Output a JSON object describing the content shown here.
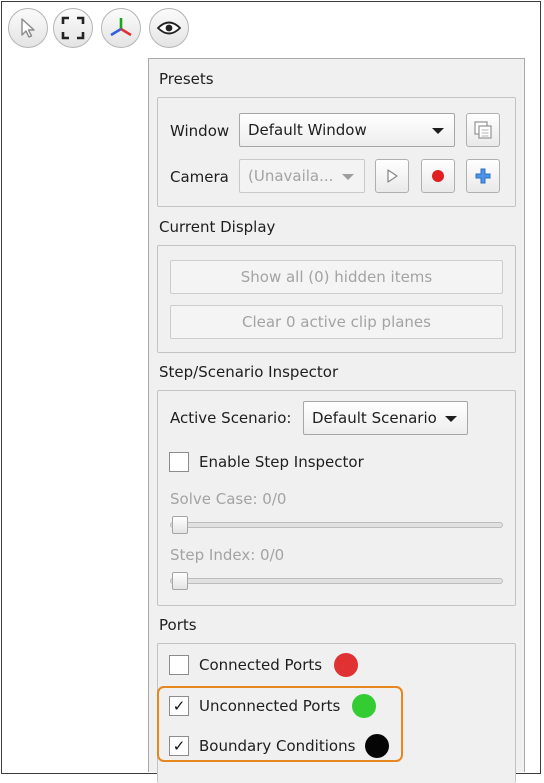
{
  "toolbar": {
    "buttons": [
      {
        "name": "select-pointer",
        "icon": "cursor-arrow-icon"
      },
      {
        "name": "fit-to-view",
        "icon": "fullscreen-corners-icon"
      },
      {
        "name": "axes-triad",
        "icon": "xyz-axes-icon"
      },
      {
        "name": "visibility",
        "icon": "eye-icon"
      }
    ]
  },
  "presets": {
    "title": "Presets",
    "window_label": "Window",
    "window_value": "Default Window",
    "camera_label": "Camera",
    "camera_value": "(Unavaila...",
    "icons": [
      "copy-window-icon",
      "play-icon",
      "record-icon",
      "add-camera-icon"
    ]
  },
  "current_display": {
    "title": "Current Display",
    "show_hidden_label": "Show all (0) hidden items",
    "clear_clip_label": "Clear 0 active clip planes"
  },
  "step_inspector": {
    "title": "Step/Scenario Inspector",
    "active_scenario_label": "Active Scenario:",
    "active_scenario_value": "Default Scenario",
    "enable_label": "Enable Step Inspector",
    "enable_checked": false,
    "solve_case_label": "Solve Case: 0/0",
    "step_index_label": "Step Index: 0/0",
    "solve_case_slider_fraction": 0,
    "step_index_slider_fraction": 0
  },
  "ports": {
    "title": "Ports",
    "items": [
      {
        "label": "Connected Ports",
        "checked": false,
        "check_glyph": "",
        "color": "#e03232"
      },
      {
        "label": "Unconnected Ports",
        "checked": true,
        "check_glyph": "✓",
        "color": "#33cc33"
      },
      {
        "label": "Boundary Conditions",
        "checked": true,
        "check_glyph": "✓",
        "color": "#050505"
      }
    ]
  },
  "colors": {
    "highlight": "#e8871e",
    "record": "#e02020",
    "add": "#2f7fd6"
  }
}
